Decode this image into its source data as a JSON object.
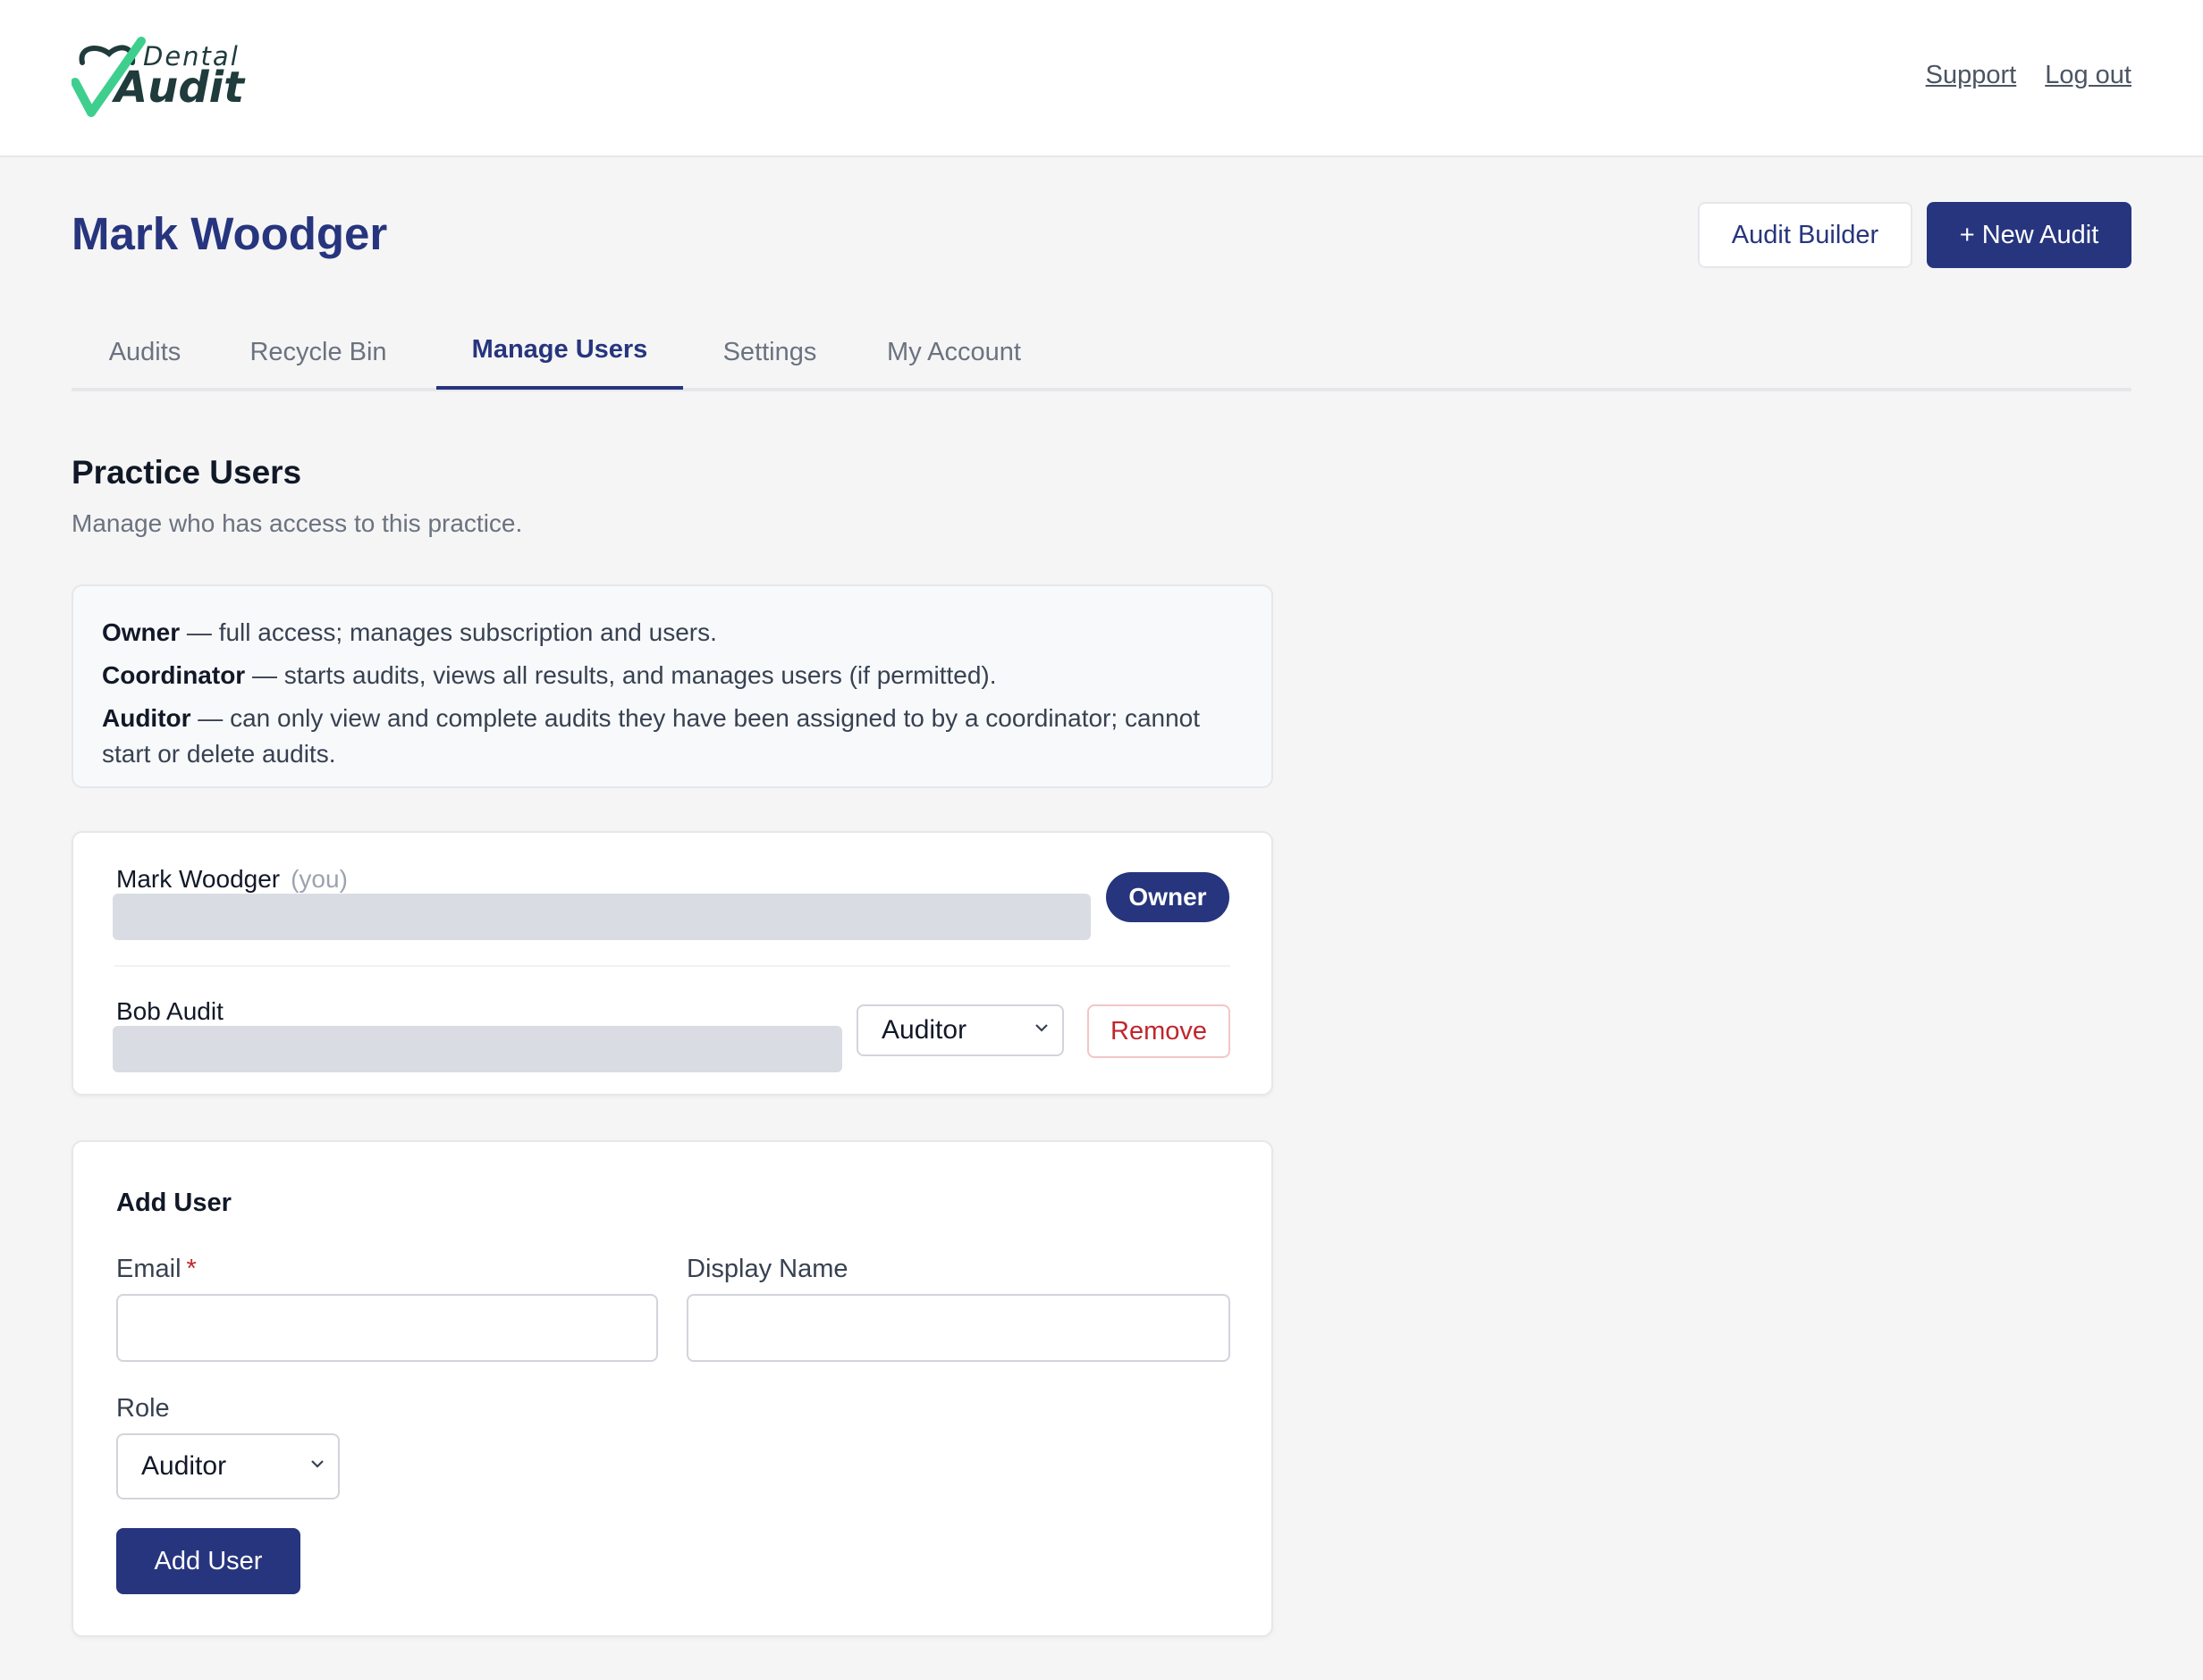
{
  "header": {
    "logo": {
      "word_top": "Dental",
      "word_main": "Audit"
    },
    "links": {
      "support": "Support",
      "logout": "Log out"
    }
  },
  "page": {
    "title": "Mark Woodger",
    "audit_builder_label": "Audit Builder",
    "new_audit_label": "+ New Audit"
  },
  "tabs": [
    {
      "label": "Audits",
      "active": false
    },
    {
      "label": "Recycle Bin",
      "active": false
    },
    {
      "label": "Manage Users",
      "active": true
    },
    {
      "label": "Settings",
      "active": false
    },
    {
      "label": "My Account",
      "active": false
    }
  ],
  "section": {
    "title": "Practice Users",
    "subtitle": "Manage who has access to this practice."
  },
  "roles_info": [
    {
      "role": "Owner",
      "desc": " — full access; manages subscription and users."
    },
    {
      "role": "Coordinator",
      "desc": " — starts audits, views all results, and manages users (if permitted)."
    },
    {
      "role": "Auditor",
      "desc": " — can only view and complete audits they have been assigned to by a coordinator; cannot start or delete audits."
    }
  ],
  "users": [
    {
      "name": "Mark Woodger",
      "you_label": "(you)",
      "badge": "Owner"
    },
    {
      "name": "Bob Audit",
      "role": "Auditor",
      "remove_label": "Remove"
    }
  ],
  "add_user": {
    "title": "Add User",
    "email_label": "Email",
    "required_mark": "*",
    "display_name_label": "Display Name",
    "email_value": "",
    "display_name_value": "",
    "role_label": "Role",
    "role_value": "Auditor",
    "submit_label": "Add User"
  },
  "colors": {
    "brand": "#27357e",
    "danger": "#c0262d",
    "logo_check": "#3ecf8e"
  }
}
